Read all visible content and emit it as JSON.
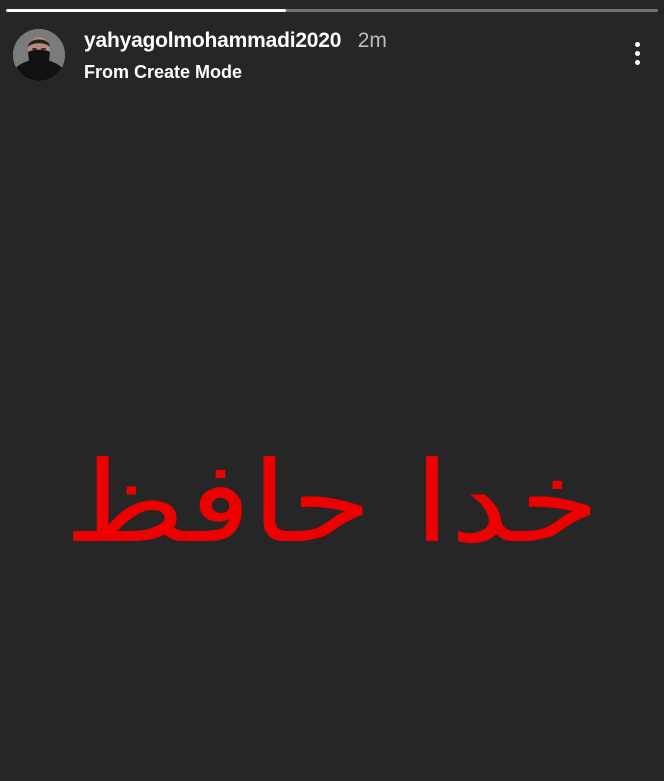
{
  "story": {
    "progress": 0.43,
    "user": {
      "username": "yahyagolmohammadi2020",
      "time": "2m",
      "subtitle": "From Create Mode"
    },
    "more_icon": "vertical-ellipsis-icon",
    "text": "خدا حافظ",
    "colors": {
      "background": "#262626",
      "text": "#ed0000",
      "primary_text": "#ffffff",
      "secondary_text": "#bdbdbd"
    }
  }
}
